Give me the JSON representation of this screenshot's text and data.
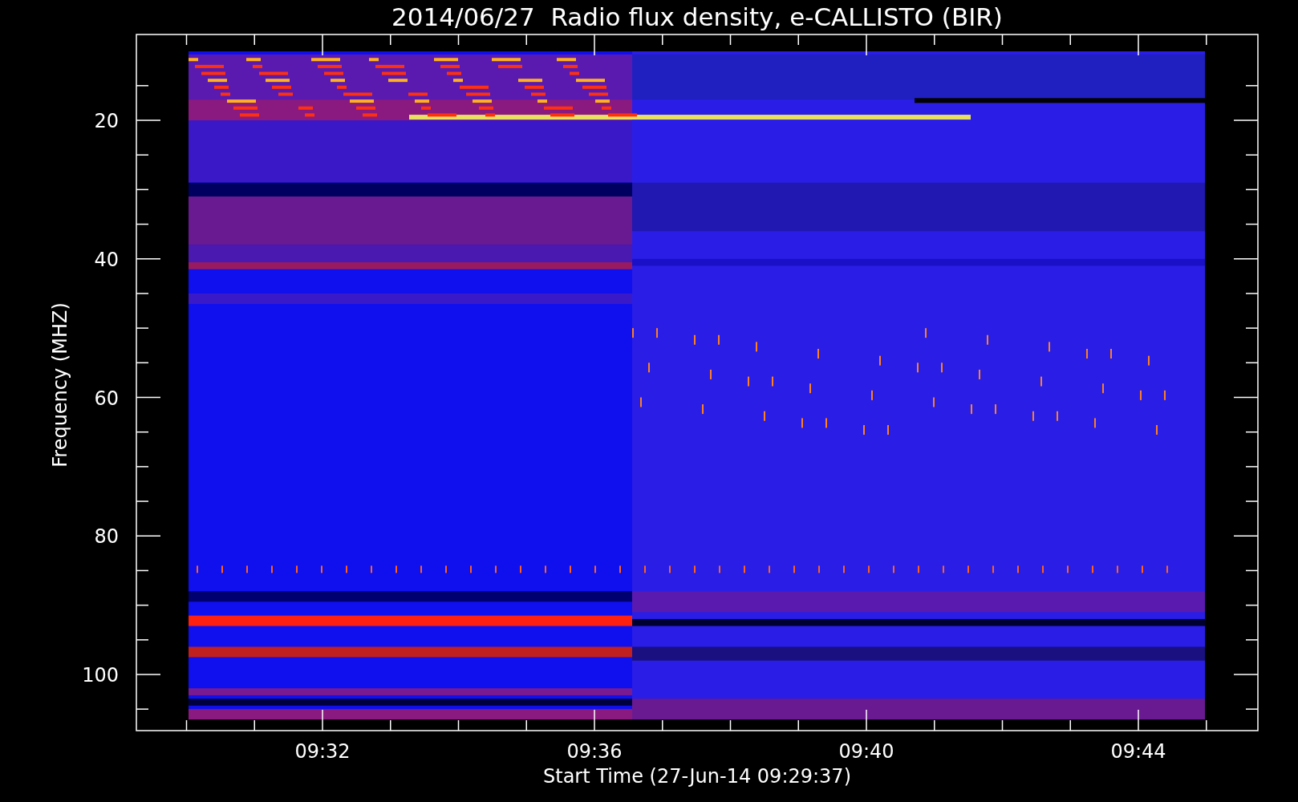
{
  "plot": {
    "title": "2014/06/27  Radio flux density, e-CALLISTO (BIR)",
    "xlabel": "Start Time (27-Jun-14 09:29:37)",
    "ylabel": "Frequency (MHZ)",
    "xtick_labels": [
      "09:32",
      "09:36",
      "09:40",
      "09:44"
    ],
    "ytick_labels": [
      "20",
      "40",
      "60",
      "80",
      "100"
    ]
  }
}
